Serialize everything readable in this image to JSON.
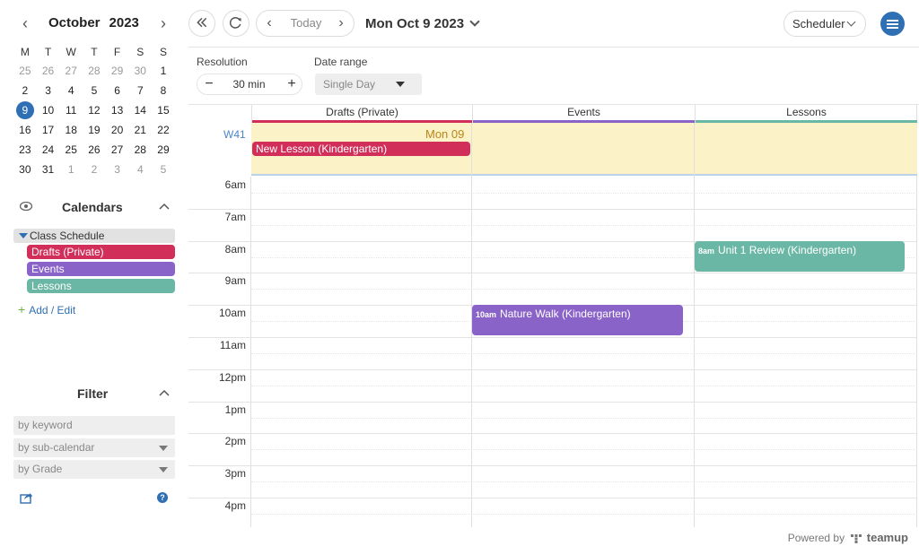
{
  "mini_calendar": {
    "month": "October",
    "year": "2023",
    "weekdays": [
      "M",
      "T",
      "W",
      "T",
      "F",
      "S",
      "S"
    ],
    "weeks": [
      [
        [
          "25",
          true
        ],
        [
          "26",
          true
        ],
        [
          "27",
          true
        ],
        [
          "28",
          true
        ],
        [
          "29",
          true
        ],
        [
          "30",
          true
        ],
        [
          "1",
          false
        ]
      ],
      [
        [
          "2",
          false
        ],
        [
          "3",
          false
        ],
        [
          "4",
          false
        ],
        [
          "5",
          false
        ],
        [
          "6",
          false
        ],
        [
          "7",
          false
        ],
        [
          "8",
          false
        ]
      ],
      [
        [
          "9",
          false
        ],
        [
          "10",
          false
        ],
        [
          "11",
          false
        ],
        [
          "12",
          false
        ],
        [
          "13",
          false
        ],
        [
          "14",
          false
        ],
        [
          "15",
          false
        ]
      ],
      [
        [
          "16",
          false
        ],
        [
          "17",
          false
        ],
        [
          "18",
          false
        ],
        [
          "19",
          false
        ],
        [
          "20",
          false
        ],
        [
          "21",
          false
        ],
        [
          "22",
          false
        ]
      ],
      [
        [
          "23",
          false
        ],
        [
          "24",
          false
        ],
        [
          "25",
          false
        ],
        [
          "26",
          false
        ],
        [
          "27",
          false
        ],
        [
          "28",
          false
        ],
        [
          "29",
          false
        ]
      ],
      [
        [
          "30",
          false
        ],
        [
          "31",
          false
        ],
        [
          "1",
          true
        ],
        [
          "2",
          true
        ],
        [
          "3",
          true
        ],
        [
          "4",
          true
        ],
        [
          "5",
          true
        ]
      ]
    ],
    "today": "9"
  },
  "calendars": {
    "title": "Calendars",
    "group": "Class Schedule",
    "items": [
      {
        "label": "Drafts (Private)",
        "color": "#d12e5a"
      },
      {
        "label": "Events",
        "color": "#8a63c9"
      },
      {
        "label": "Lessons",
        "color": "#6bb7a5"
      }
    ],
    "add_edit": "Add / Edit"
  },
  "filter": {
    "title": "Filter",
    "keyword_placeholder": "by keyword",
    "subcalendar_label": "by sub-calendar",
    "grade_label": "by Grade"
  },
  "toolbar": {
    "today_label": "Today",
    "date_title": "Mon Oct 9 2023",
    "view_label": "Scheduler"
  },
  "options": {
    "resolution_label": "Resolution",
    "resolution_value": "30 min",
    "date_range_label": "Date range",
    "date_range_value": "Single Day"
  },
  "grid": {
    "week_number": "W41",
    "day_label": "Mon 09",
    "columns": [
      {
        "label": "Drafts (Private)",
        "color": "#d12e5a"
      },
      {
        "label": "Events",
        "color": "#8a63c9"
      },
      {
        "label": "Lessons",
        "color": "#6bb7a5"
      }
    ],
    "times": [
      "6am",
      "7am",
      "8am",
      "9am",
      "10am",
      "11am",
      "12pm",
      "1pm",
      "2pm",
      "3pm",
      "4pm"
    ],
    "allday_event": {
      "label": "New Lesson (Kindergarten)",
      "color": "#d12e5a"
    },
    "events": [
      {
        "time": "10am",
        "title": "Nature Walk (Kindergarten)",
        "color": "#8a63c9"
      },
      {
        "time": "8am",
        "title": "Unit 1 Review (Kindergarten)",
        "color": "#6bb7a5"
      }
    ]
  },
  "footer": {
    "powered_by": "Powered by",
    "brand": "teamup"
  },
  "accent_color": "#2f6fb3"
}
